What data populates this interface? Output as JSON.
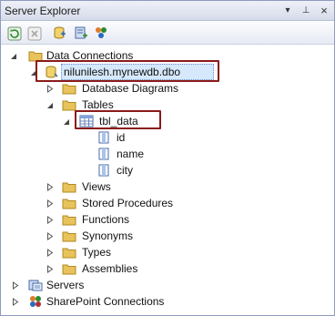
{
  "window": {
    "title": "Server Explorer",
    "controls": {
      "dropdown": "▾",
      "pin": "⊥",
      "close": "×"
    }
  },
  "toolbar": {
    "buttons": [
      {
        "name": "refresh-button",
        "icon": "refresh-icon"
      },
      {
        "name": "stop-button",
        "icon": "stop-icon"
      },
      {
        "name": "connect-to-database-button",
        "icon": "connect-database-icon"
      },
      {
        "name": "connect-to-server-button",
        "icon": "connect-server-icon"
      },
      {
        "name": "connect-to-sharepoint-button",
        "icon": "connect-sharepoint-icon"
      }
    ]
  },
  "tree": {
    "data_connections": "Data Connections",
    "connection": "nilunilesh.mynewdb.dbo",
    "database_diagrams": "Database Diagrams",
    "tables": "Tables",
    "tbl_data": "tbl_data",
    "columns": [
      "id",
      "name",
      "city"
    ],
    "views": "Views",
    "stored_procedures": "Stored Procedures",
    "functions": "Functions",
    "synonyms": "Synonyms",
    "types": "Types",
    "assemblies": "Assemblies",
    "servers": "Servers",
    "sharepoint": "SharePoint Connections"
  },
  "colors": {
    "highlight_border": "#8b1a1a",
    "folder": "#e8c25a",
    "selection": "#d6e8fb"
  }
}
